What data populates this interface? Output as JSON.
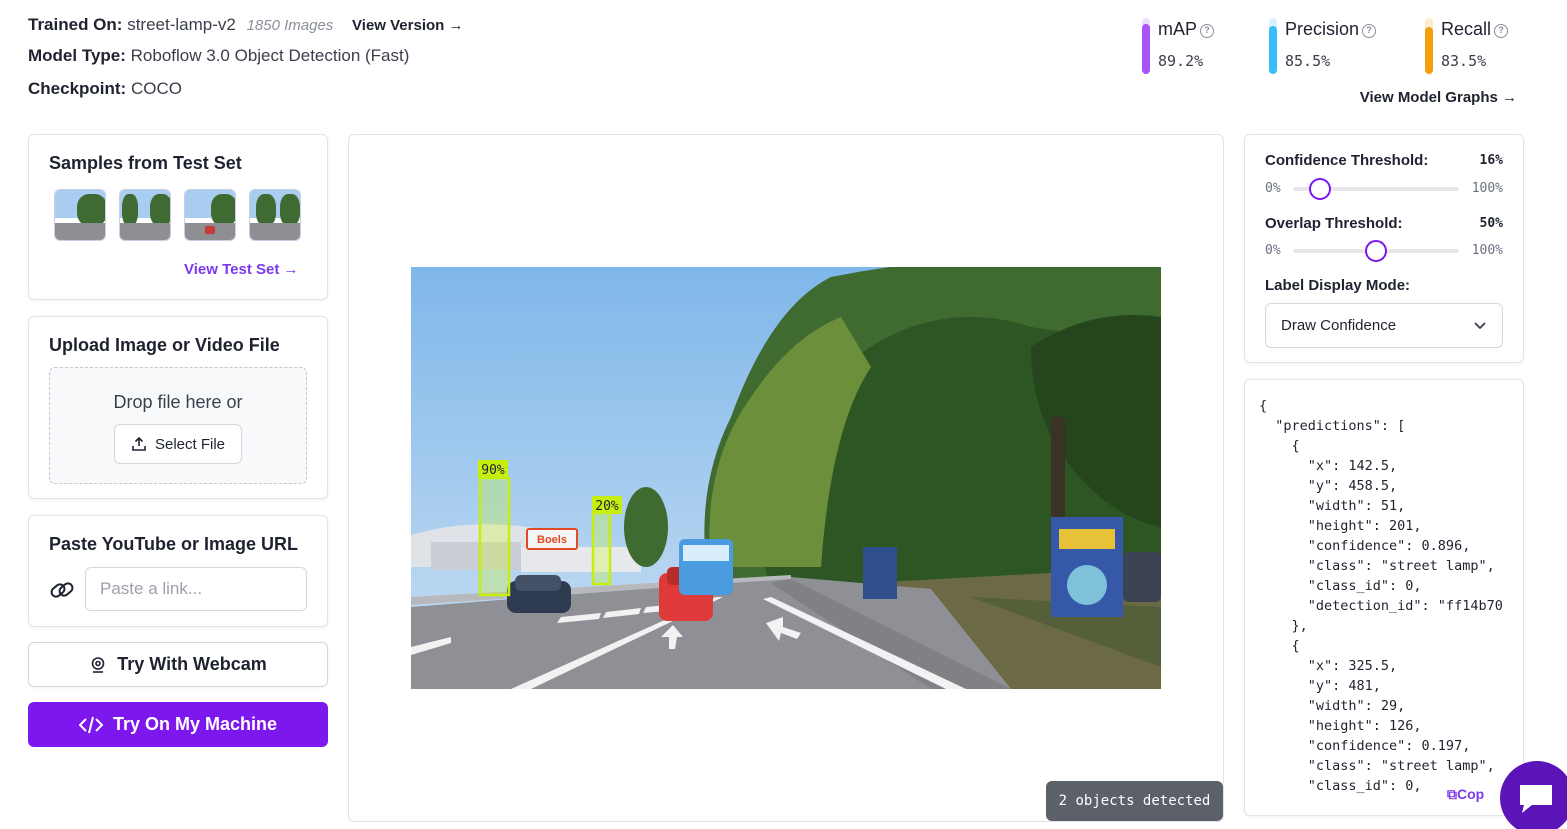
{
  "header": {
    "trained_on_key": "Trained On:",
    "trained_on_value": "street-lamp-v2",
    "image_count": "1850 Images",
    "view_version": "View Version",
    "model_type_key": "Model Type:",
    "model_type_value": "Roboflow 3.0 Object Detection (Fast)",
    "checkpoint_key": "Checkpoint:",
    "checkpoint_value": "COCO",
    "view_graphs": "View Model Graphs"
  },
  "metrics": [
    {
      "label": "mAP",
      "value": "89.2%",
      "fraction": 0.892,
      "color": "#a855f7"
    },
    {
      "label": "Precision",
      "value": "85.5%",
      "fraction": 0.855,
      "color": "#38bdf8"
    },
    {
      "label": "Recall",
      "value": "83.5%",
      "fraction": 0.835,
      "color": "#f59e0b"
    }
  ],
  "samples": {
    "title": "Samples from Test Set",
    "link": "View Test Set"
  },
  "upload": {
    "title": "Upload Image or Video File",
    "drop_text": "Drop file here or",
    "select_label": "Select File"
  },
  "paste": {
    "title": "Paste YouTube or Image URL",
    "placeholder": "Paste a link..."
  },
  "actions": {
    "webcam": "Try With Webcam",
    "machine": "Try On My Machine"
  },
  "preview": {
    "detections": [
      {
        "label": "90%",
        "confidence": 0.896
      },
      {
        "label": "20%",
        "confidence": 0.197
      }
    ],
    "sign_text": "Boels",
    "status": "2 objects detected"
  },
  "settings": {
    "confidence_label": "Confidence Threshold:",
    "confidence_value": "16%",
    "confidence_fraction": 0.16,
    "overlap_label": "Overlap Threshold:",
    "overlap_value": "50%",
    "overlap_fraction": 0.5,
    "min": "0%",
    "max": "100%",
    "label_mode_label": "Label Display Mode:",
    "label_mode_value": "Draw Confidence"
  },
  "json_output": {
    "text": "{\n  \"predictions\": [\n    {\n      \"x\": 142.5,\n      \"y\": 458.5,\n      \"width\": 51,\n      \"height\": 201,\n      \"confidence\": 0.896,\n      \"class\": \"street lamp\",\n      \"class_id\": 0,\n      \"detection_id\": \"ff14b70\n    },\n    {\n      \"x\": 325.5,\n      \"y\": 481,\n      \"width\": 29,\n      \"height\": 126,\n      \"confidence\": 0.197,\n      \"class\": \"street lamp\",\n      \"class_id\": 0,",
    "copy_label": "Cop"
  }
}
